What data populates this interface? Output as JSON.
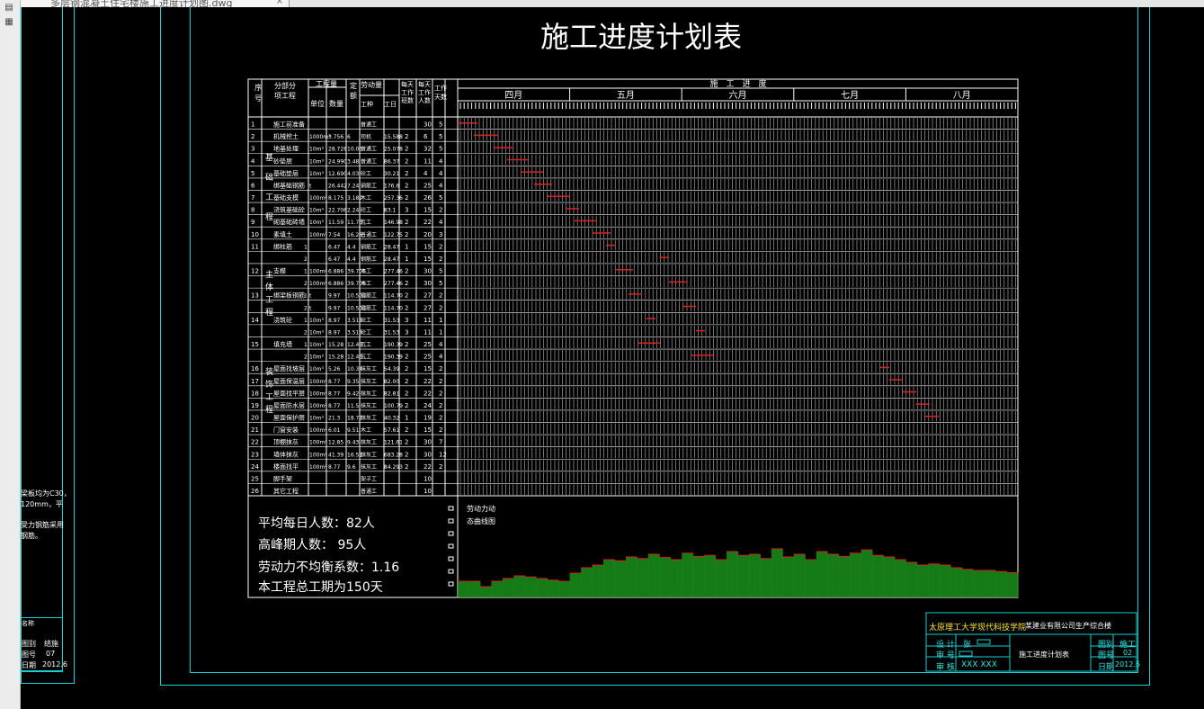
{
  "tab": {
    "title": "多层钢混凝土住宅楼施工进度计划图.dwg",
    "close": "×"
  },
  "sidebar": {
    "icons": [
      "layers-icon",
      "layout-icon"
    ]
  },
  "title": "施工进度计划表",
  "table": {
    "headers": {
      "seq": "序号",
      "item": "分部分项工程",
      "qty_group": "工程量",
      "unit": "单位",
      "qty": "数量",
      "quota": "定额",
      "labor_group": "劳动量",
      "trade": "工种",
      "workday": "工日",
      "shifts": "每天工作班数",
      "persons": "每天工作人数",
      "days": "工作天数",
      "progress": "施　工　进　度"
    },
    "months": [
      "四月",
      "五月",
      "六月",
      "七月",
      "八月"
    ],
    "groups": [
      "基础工程",
      "主体工程",
      "装饰工程"
    ],
    "rows": [
      [
        "1",
        "施工前准备",
        "",
        "",
        "",
        "普通工",
        "",
        "",
        "30",
        "5"
      ],
      [
        "2",
        "机械挖土",
        "1000m³",
        "3.756",
        "6",
        "司机",
        "15.588",
        "2",
        "6",
        "5"
      ],
      [
        "3",
        "地基处理",
        "10m³",
        "28.728",
        "10.06",
        "普通工",
        "25.078",
        "2",
        "32",
        "5"
      ],
      [
        "4",
        "砂垫层",
        "10m³",
        "24.990",
        "3.48",
        "普通工",
        "86.37",
        "2",
        "11",
        "4"
      ],
      [
        "5",
        "基础垫层",
        "10m³",
        "12.690",
        "4.03",
        "砼工",
        "30.21",
        "2",
        "4",
        "4"
      ],
      [
        "6",
        "绑基础钢筋",
        "t",
        "26.442",
        "7.24",
        "钢筋工",
        "176.6",
        "2",
        "25",
        "4"
      ],
      [
        "7",
        "基础支模",
        "100m²",
        "8.175",
        "3.187",
        "木工",
        "257.36",
        "2",
        "26",
        "5"
      ],
      [
        "8",
        "浇筑基础砼",
        "10m³",
        "22.706",
        "2.24",
        "砼工",
        "83.1",
        "3",
        "15",
        "2"
      ],
      [
        "9",
        "砌基础砖墙",
        "10m³",
        "11.59",
        "11.73",
        "瓦工",
        "146.98",
        "2",
        "22",
        "4"
      ],
      [
        "10",
        "素填土",
        "100m³",
        "7.54",
        "16.28",
        "普通工",
        "122.75",
        "2",
        "20",
        "3"
      ],
      [
        "11",
        "绑柱筋",
        "1",
        "",
        "6.47",
        "4.4",
        "钢筋工",
        "28.47",
        "1",
        "15",
        "2"
      ],
      [
        "",
        "",
        "2",
        "",
        "6.47",
        "4.4",
        "钢筋工",
        "28.47",
        "1",
        "15",
        "2"
      ],
      [
        "12",
        "支模",
        "1",
        "100m²",
        "6.886",
        "39.706",
        "木工",
        "277.46",
        "2",
        "30",
        "5"
      ],
      [
        "",
        "",
        "2",
        "100m²",
        "6.886",
        "39.706",
        "木工",
        "277.46",
        "2",
        "30",
        "5"
      ],
      [
        "13",
        "绑梁板钢筋",
        "1",
        "t",
        "9.97",
        "10.501",
        "钢筋工",
        "114.70",
        "2",
        "27",
        "2"
      ],
      [
        "",
        "",
        "2",
        "t",
        "9.97",
        "10.501",
        "钢筋工",
        "114.70",
        "2",
        "27",
        "2"
      ],
      [
        "14",
        "浇筑砼",
        "1",
        "10m³",
        "8.97",
        "3.515",
        "砼工",
        "31.53",
        "3",
        "11",
        "1"
      ],
      [
        "",
        "",
        "2",
        "10m³",
        "8.97",
        "3.515",
        "砼工",
        "31.53",
        "3",
        "11",
        "1"
      ],
      [
        "15",
        "填充墙",
        "1",
        "10m³",
        "15.28",
        "12.46",
        "瓦工",
        "190.39",
        "2",
        "25",
        "4"
      ],
      [
        "",
        "",
        "2",
        "10m³",
        "15.28",
        "12.46",
        "瓦工",
        "190.39",
        "2",
        "25",
        "4"
      ],
      [
        "16",
        "屋面找坡层",
        "10m³",
        "5.26",
        "10.34",
        "抹灰工",
        "54.39",
        "2",
        "15",
        "2"
      ],
      [
        "17",
        "屋面保温层",
        "100m²",
        "8.77",
        "9.35",
        "抹灰工",
        "82.00",
        "2",
        "22",
        "2"
      ],
      [
        "18",
        "屋面找平层",
        "100m²",
        "8.77",
        "9.42",
        "抹灰工",
        "82.81",
        "2",
        "22",
        "2"
      ],
      [
        "19",
        "屋面防水层",
        "100m²",
        "8.77",
        "11.5",
        "抹灰工",
        "100.79",
        "2",
        "24",
        "2"
      ],
      [
        "20",
        "屋面保护层",
        "10m³",
        "21.3",
        "18.77",
        "抹灰工",
        "40.32",
        "1",
        "19",
        "2"
      ],
      [
        "21",
        "门窗安装",
        "100m²",
        "6.01",
        "9.51",
        "木工",
        "57.61",
        "2",
        "15",
        "2"
      ],
      [
        "22",
        "顶棚抹灰",
        "100m²",
        "12.85",
        "9.43",
        "抹灰工",
        "121.61",
        "2",
        "30",
        "7"
      ],
      [
        "23",
        "墙体抹灰",
        "100m²",
        "41.39",
        "16.51",
        "抹灰工",
        "683.28",
        "2",
        "30",
        "12"
      ],
      [
        "24",
        "楼面找平",
        "100m²",
        "8.77",
        "9.6",
        "抹灰工",
        "84.293",
        "2",
        "22",
        "2"
      ],
      [
        "25",
        "脚手架",
        "",
        "",
        "",
        "架子工",
        "",
        "",
        "10",
        ""
      ],
      [
        "26",
        "其它工程",
        "",
        "",
        "",
        "普通工",
        "",
        "",
        "10",
        ""
      ]
    ]
  },
  "stats": {
    "avg": "平均每日人数：82人",
    "peak": "高峰期人数：  95人",
    "coef": "劳动力不均衡系数：1.16",
    "total": "本工程总工期为150天"
  },
  "labor_chart": {
    "title_line1": "劳动力动",
    "title_line2": "态曲线图",
    "fill_color": "#1a8f1a",
    "line_color": "#e02020"
  },
  "title_block": {
    "school": "太原理工大学现代科技学院",
    "company": "某建业有限公司生产综合楼",
    "design_label": "设 计",
    "design_value": "张",
    "check_label": "审 号",
    "review_label": "审 核",
    "review_value": "XXX  XXX",
    "drawing_name": "施工进度计划表",
    "sheet_label": "图别",
    "sheet_value": "施工",
    "no_label": "图号",
    "no_value": "02",
    "date_label": "日期",
    "date_value": "2012.6"
  },
  "left_sheet": {
    "note1": "梁板均为C30，",
    "note2": "120mm，平",
    "note3": "受力钢筋采用",
    "note4": "钢筋。",
    "name": "名称",
    "r1_label": "图别",
    "r1_value": "结施",
    "r2_label": "图号",
    "r2_value": "07",
    "r3_label": "日期",
    "r3_value": "2012.6"
  }
}
